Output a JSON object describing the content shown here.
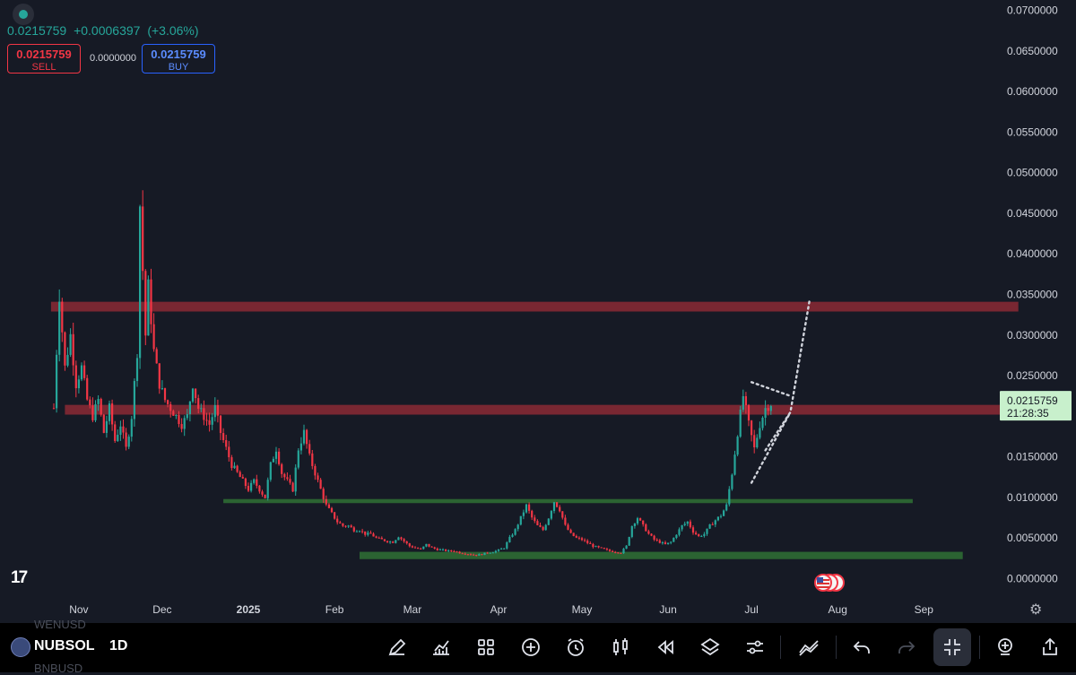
{
  "header": {
    "price": "0.0215759",
    "change": "+0.0006397",
    "change_pct": "(+3.06%)",
    "sell_price": "0.0215759",
    "sell_label": "SELL",
    "spread": "0.0000000",
    "buy_price": "0.0215759",
    "buy_label": "BUY",
    "logo": "17"
  },
  "colors": {
    "background": "#161a25",
    "up": "#26a69a",
    "down": "#f23645",
    "resistance_zone": "#8b2a35",
    "support_zone": "#2e6b34",
    "price_tag": "#c8f0cc"
  },
  "chart_data": {
    "type": "candlestick",
    "interval": "1D",
    "y_range": [
      -0.0005,
      0.0705
    ],
    "y_ticks": [
      "0.0700000",
      "0.0650000",
      "0.0600000",
      "0.0550000",
      "0.0500000",
      "0.0450000",
      "0.0400000",
      "0.0350000",
      "0.0300000",
      "0.0250000",
      "0.0200000",
      "0.0150000",
      "0.0100000",
      "0.0050000",
      "0.0000000"
    ],
    "x_ticks": [
      "Nov",
      "Dec",
      "2025",
      "Feb",
      "Mar",
      "Apr",
      "May",
      "Jun",
      "Jul",
      "Aug",
      "Sep"
    ],
    "x_tick_days": [
      9,
      39,
      70,
      101,
      129,
      160,
      190,
      221,
      251,
      282,
      313
    ],
    "last_day": 274,
    "close_series": [
      [
        0,
        0.021
      ],
      [
        2,
        0.035
      ],
      [
        4,
        0.026
      ],
      [
        6,
        0.03
      ],
      [
        8,
        0.024
      ],
      [
        10,
        0.026
      ],
      [
        12,
        0.022
      ],
      [
        14,
        0.02
      ],
      [
        16,
        0.022
      ],
      [
        18,
        0.018
      ],
      [
        20,
        0.021
      ],
      [
        22,
        0.017
      ],
      [
        24,
        0.019
      ],
      [
        26,
        0.016
      ],
      [
        28,
        0.02
      ],
      [
        30,
        0.028
      ],
      [
        31,
        0.046
      ],
      [
        32,
        0.038
      ],
      [
        33,
        0.03
      ],
      [
        34,
        0.036
      ],
      [
        36,
        0.028
      ],
      [
        38,
        0.024
      ],
      [
        40,
        0.022
      ],
      [
        42,
        0.021
      ],
      [
        44,
        0.02
      ],
      [
        46,
        0.019
      ],
      [
        48,
        0.02
      ],
      [
        50,
        0.024
      ],
      [
        52,
        0.021
      ],
      [
        54,
        0.02
      ],
      [
        56,
        0.019
      ],
      [
        58,
        0.021
      ],
      [
        60,
        0.018
      ],
      [
        62,
        0.016
      ],
      [
        64,
        0.014
      ],
      [
        66,
        0.013
      ],
      [
        68,
        0.012
      ],
      [
        70,
        0.011
      ],
      [
        72,
        0.012
      ],
      [
        74,
        0.011
      ],
      [
        76,
        0.01
      ],
      [
        78,
        0.014
      ],
      [
        80,
        0.016
      ],
      [
        82,
        0.013
      ],
      [
        84,
        0.012
      ],
      [
        86,
        0.011
      ],
      [
        88,
        0.016
      ],
      [
        90,
        0.018
      ],
      [
        92,
        0.015
      ],
      [
        94,
        0.013
      ],
      [
        96,
        0.011
      ],
      [
        98,
        0.009
      ],
      [
        100,
        0.008
      ],
      [
        102,
        0.007
      ],
      [
        104,
        0.0065
      ],
      [
        106,
        0.0065
      ],
      [
        108,
        0.006
      ],
      [
        110,
        0.006
      ],
      [
        112,
        0.0055
      ],
      [
        114,
        0.0055
      ],
      [
        116,
        0.005
      ],
      [
        118,
        0.0048
      ],
      [
        120,
        0.0046
      ],
      [
        122,
        0.0045
      ],
      [
        124,
        0.0052
      ],
      [
        126,
        0.0046
      ],
      [
        128,
        0.004
      ],
      [
        130,
        0.0038
      ],
      [
        132,
        0.0036
      ],
      [
        134,
        0.0042
      ],
      [
        136,
        0.0038
      ],
      [
        138,
        0.0036
      ],
      [
        140,
        0.0035
      ],
      [
        142,
        0.0034
      ],
      [
        144,
        0.0034
      ],
      [
        146,
        0.0032
      ],
      [
        148,
        0.0031
      ],
      [
        150,
        0.003
      ],
      [
        152,
        0.0029
      ],
      [
        154,
        0.003
      ],
      [
        156,
        0.0032
      ],
      [
        158,
        0.0033
      ],
      [
        160,
        0.0035
      ],
      [
        162,
        0.0038
      ],
      [
        164,
        0.005
      ],
      [
        166,
        0.006
      ],
      [
        168,
        0.0075
      ],
      [
        170,
        0.009
      ],
      [
        172,
        0.0075
      ],
      [
        174,
        0.0065
      ],
      [
        176,
        0.006
      ],
      [
        178,
        0.0075
      ],
      [
        180,
        0.0095
      ],
      [
        182,
        0.0085
      ],
      [
        184,
        0.0065
      ],
      [
        186,
        0.0055
      ],
      [
        188,
        0.005
      ],
      [
        190,
        0.0048
      ],
      [
        192,
        0.0044
      ],
      [
        194,
        0.004
      ],
      [
        196,
        0.0038
      ],
      [
        198,
        0.0036
      ],
      [
        200,
        0.0034
      ],
      [
        202,
        0.0033
      ],
      [
        204,
        0.0032
      ],
      [
        206,
        0.004
      ],
      [
        208,
        0.0065
      ],
      [
        210,
        0.0075
      ],
      [
        212,
        0.0065
      ],
      [
        214,
        0.0055
      ],
      [
        216,
        0.0048
      ],
      [
        218,
        0.0045
      ],
      [
        220,
        0.0042
      ],
      [
        222,
        0.0045
      ],
      [
        224,
        0.0055
      ],
      [
        226,
        0.0065
      ],
      [
        228,
        0.007
      ],
      [
        230,
        0.0058
      ],
      [
        232,
        0.0052
      ],
      [
        234,
        0.0055
      ],
      [
        236,
        0.0065
      ],
      [
        238,
        0.0072
      ],
      [
        240,
        0.0078
      ],
      [
        242,
        0.009
      ],
      [
        244,
        0.013
      ],
      [
        246,
        0.018
      ],
      [
        248,
        0.0225
      ],
      [
        250,
        0.019
      ],
      [
        252,
        0.016
      ],
      [
        254,
        0.019
      ],
      [
        256,
        0.021
      ],
      [
        258,
        0.0215759
      ]
    ],
    "support_levels": [
      {
        "y0": 0.0093,
        "y1": 0.0098,
        "x0": 61,
        "x1": 309
      },
      {
        "y0": 0.0024,
        "y1": 0.0033,
        "x0": 110,
        "x1": 327
      }
    ],
    "resistance_levels": [
      {
        "y0": 0.0329,
        "y1": 0.0341,
        "x0": -1,
        "x1": 347
      },
      {
        "y0": 0.0202,
        "y1": 0.0214,
        "x0": 4,
        "x1": 346
      }
    ],
    "projection": [
      [
        256,
        0.0158
      ],
      [
        265,
        0.0205
      ],
      [
        272,
        0.0345
      ]
    ],
    "wedge_upper": [
      [
        251,
        0.0242
      ],
      [
        265,
        0.0225
      ]
    ],
    "wedge_lower": [
      [
        251,
        0.0118
      ],
      [
        265,
        0.0205
      ]
    ],
    "last_price": "0.0215759",
    "countdown": "21:28:35"
  },
  "toolbar": {
    "symbol": "NUBSOL",
    "timeframe": "1D",
    "ghost_above": "WENUSD",
    "ghost_below": "BNBUSD",
    "icons": [
      "pencil-icon",
      "indicators-icon",
      "grid-icon",
      "plus-icon",
      "alarm-icon",
      "candles-icon",
      "replay-icon",
      "layers-icon",
      "settings-sliders-icon",
      "trendline-icon",
      "undo-icon",
      "redo-icon",
      "collapse-icon",
      "add-alert-icon",
      "share-icon"
    ]
  }
}
